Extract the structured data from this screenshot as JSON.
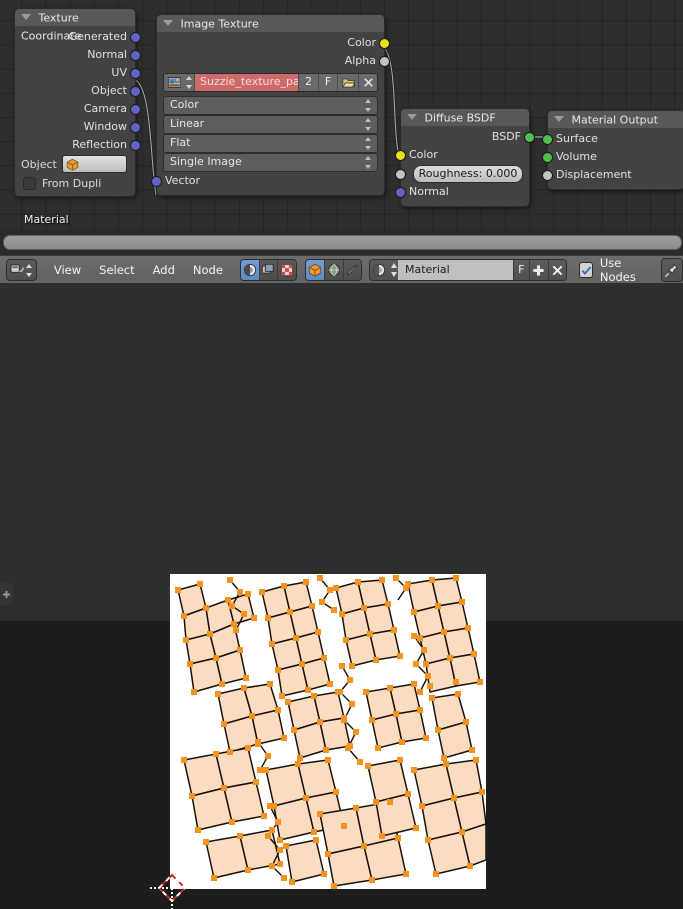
{
  "node_editor": {
    "breadcrumb": "Material",
    "nodes": [
      {
        "id": "texture_coordinate",
        "title": "Texture Coordinate",
        "outputs": [
          "Generated",
          "Normal",
          "UV",
          "Object",
          "Camera",
          "Window",
          "Reflection"
        ],
        "object_label": "Object",
        "object_value": "",
        "object_icon": "object-cube-icon",
        "from_dupli_label": "From Dupli",
        "from_dupli_checked": false
      },
      {
        "id": "image_texture",
        "title": "Image Texture",
        "outputs": [
          "Color",
          "Alpha"
        ],
        "datablock": {
          "image_icon": "image-datablock-icon",
          "name": "Suzzie_texture_paint",
          "users": "2",
          "fake_user": "F",
          "open_icon": "open-file-icon",
          "unlink_icon": "unlink-x-icon",
          "name_bg": "#cf6a6a"
        },
        "dropdowns": [
          "Color",
          "Linear",
          "Flat",
          "Single Image"
        ],
        "inputs": [
          "Vector"
        ]
      },
      {
        "id": "diffuse_bsdf",
        "title": "Diffuse BSDF",
        "outputs": [
          "BSDF"
        ],
        "inputs": [
          "Color",
          "Normal"
        ],
        "roughness": "Roughness: 0.000"
      },
      {
        "id": "material_output",
        "title": "Material Output",
        "inputs": [
          "Surface",
          "Volume",
          "Displacement"
        ]
      }
    ],
    "socket_colors": {
      "vector": "#6363c7",
      "color": "#e2e21f",
      "gray": "#c3c3c3",
      "shader": "#4ec04e"
    }
  },
  "header": {
    "editor_type_icon": "node-editor-type-icon",
    "menus": [
      "View",
      "Select",
      "Add",
      "Node"
    ],
    "shader_type_toggles": [
      {
        "name": "shader-nodes-toggle",
        "icon": "shader-ball-icon",
        "active": true
      },
      {
        "name": "compositing-nodes-toggle",
        "icon": "compositing-icon",
        "active": false
      },
      {
        "name": "texture-nodes-toggle",
        "icon": "texture-checker-icon",
        "active": false
      }
    ],
    "shader_source_toggles": [
      {
        "name": "object-shader-toggle",
        "icon": "object-cube-icon",
        "active": true
      },
      {
        "name": "world-shader-toggle",
        "icon": "world-globe-icon",
        "active": false
      },
      {
        "name": "brush-shader-toggle",
        "icon": "brush-pen-icon",
        "active": false
      }
    ],
    "material_datablock": {
      "icon": "material-ball-icon",
      "name": "Material",
      "fake_user": "F",
      "new_label": "+",
      "unlink_label": "X"
    },
    "use_nodes_label": "Use Nodes",
    "use_nodes_checked": true,
    "pin_icon": "pin-icon"
  },
  "image_editor": {
    "canvas_bg": "#ffffff",
    "uv_vertex_color": "#f2921f",
    "uv_edge_color": "#1a1008",
    "uv_face_color": "#fadcc0",
    "toolbar_tab_icon": "plus-icon",
    "cursor_2d_icon": "cursor-2d-icon"
  }
}
